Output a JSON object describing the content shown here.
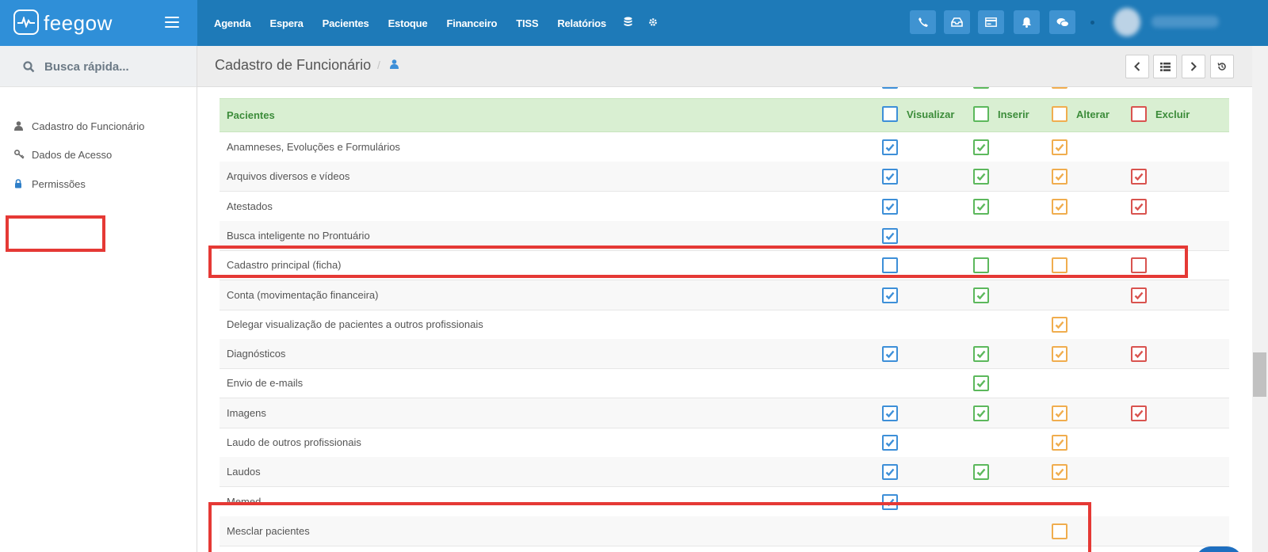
{
  "brand": {
    "name": "feegow"
  },
  "nav": {
    "items": [
      "Agenda",
      "Espera",
      "Pacientes",
      "Estoque",
      "Financeiro",
      "TISS",
      "Relatórios"
    ],
    "icons": [
      "database-icon",
      "gear-icon"
    ],
    "tools": [
      "phone-icon",
      "inbox-icon",
      "card-icon",
      "bell-icon",
      "chat-icon"
    ]
  },
  "sidebar": {
    "search_placeholder": "Busca rápida...",
    "items": [
      {
        "label": "Cadastro do Funcionário",
        "icon": "user-icon"
      },
      {
        "label": "Dados de Acesso",
        "icon": "key-icon"
      },
      {
        "label": "Permissões",
        "icon": "lock-icon"
      }
    ]
  },
  "header": {
    "title": "Cadastro de Funcionário"
  },
  "permissions": {
    "group": "Pacientes",
    "columns": [
      "Visualizar",
      "Inserir",
      "Alterar",
      "Excluir"
    ],
    "column_colors": [
      "#3d8fd8",
      "#5cb85c",
      "#f0ad4e",
      "#d9534f"
    ],
    "rows": [
      {
        "label": "Anamneses, Evoluções e Formulários",
        "v": [
          true,
          true,
          true,
          null
        ]
      },
      {
        "label": "Arquivos diversos e vídeos",
        "v": [
          true,
          true,
          true,
          true
        ]
      },
      {
        "label": "Atestados",
        "v": [
          true,
          true,
          true,
          true
        ]
      },
      {
        "label": "Busca inteligente no Prontuário",
        "v": [
          true,
          null,
          null,
          null
        ]
      },
      {
        "label": "Cadastro principal (ficha)",
        "v": [
          false,
          false,
          false,
          false
        ]
      },
      {
        "label": "Conta (movimentação financeira)",
        "v": [
          true,
          true,
          null,
          true
        ]
      },
      {
        "label": "Delegar visualização de pacientes a outros profissionais",
        "v": [
          null,
          null,
          true,
          null
        ]
      },
      {
        "label": "Diagnósticos",
        "v": [
          true,
          true,
          true,
          true
        ]
      },
      {
        "label": "Envio de e-mails",
        "v": [
          null,
          true,
          null,
          null
        ]
      },
      {
        "label": "Imagens",
        "v": [
          true,
          true,
          true,
          true
        ]
      },
      {
        "label": "Laudo de outros profissionais",
        "v": [
          true,
          null,
          true,
          null
        ]
      },
      {
        "label": "Laudos",
        "v": [
          true,
          true,
          true,
          null
        ]
      },
      {
        "label": "Memed",
        "v": [
          true,
          null,
          null,
          null
        ]
      },
      {
        "label": "Mesclar pacientes",
        "v": [
          null,
          null,
          false,
          null
        ]
      }
    ]
  }
}
